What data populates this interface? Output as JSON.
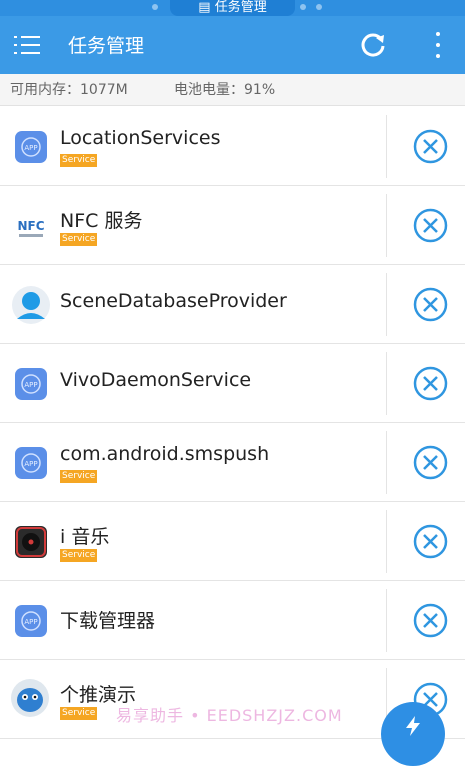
{
  "status_strip": {
    "title": "任务管理"
  },
  "header": {
    "title": "任务管理"
  },
  "info": {
    "memory": "可用内存：1077M",
    "battery": "电池电量：91%"
  },
  "tasks": [
    {
      "name": "LocationServices",
      "badge": "Service",
      "icon": "app-default-icon"
    },
    {
      "name": "NFC 服务",
      "badge": "Service",
      "icon": "nfc-icon"
    },
    {
      "name": "SceneDatabaseProvider",
      "badge": "",
      "icon": "avatar-person-icon"
    },
    {
      "name": "VivoDaemonService",
      "badge": "",
      "icon": "app-default-icon"
    },
    {
      "name": "com.android.smspush",
      "badge": "Service",
      "icon": "app-default-icon"
    },
    {
      "name": "i 音乐",
      "badge": "Service",
      "icon": "music-player-icon"
    },
    {
      "name": "下载管理器",
      "badge": "",
      "icon": "app-default-icon"
    },
    {
      "name": "个推演示",
      "badge": "Service",
      "icon": "mascot-icon"
    }
  ],
  "watermark": "易享助手 • EEDSHZJZ.COM",
  "colors": {
    "primary": "#3b9ae6",
    "badge": "#f5a623",
    "close": "#2f96e0"
  }
}
